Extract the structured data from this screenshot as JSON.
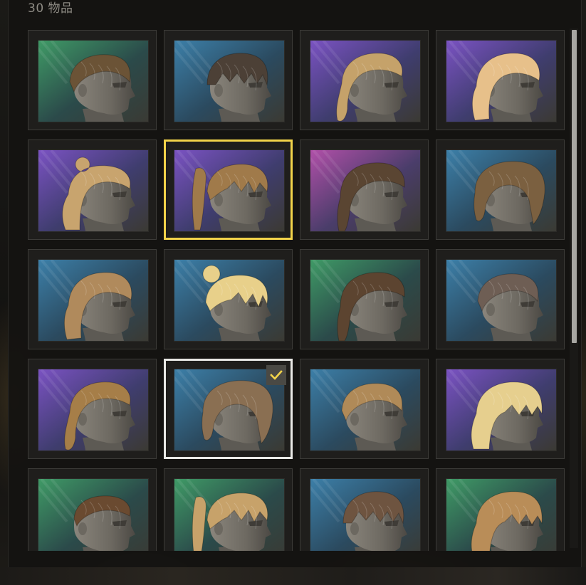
{
  "header": {
    "item_count": "30 物品"
  },
  "colors": {
    "focus_border": "#f2d34a",
    "equipped_border": "#e9e9e6",
    "check": "#f2d34a",
    "backgrounds": {
      "green": [
        "#3f9a66",
        "#2b4a4a",
        "#3a3a34"
      ],
      "blue": [
        "#3c7fa8",
        "#2b4a5f",
        "#3b3a33"
      ],
      "purple": [
        "#7a52c2",
        "#3f3d6e",
        "#3b3a33"
      ],
      "pink": [
        "#b04fa8",
        "#4a3d6a",
        "#3b3a33"
      ]
    }
  },
  "items": [
    {
      "bg": "green",
      "hair": "#6b5336",
      "style": "slick"
    },
    {
      "bg": "blue",
      "hair": "#4c4036",
      "style": "fringe"
    },
    {
      "bg": "purple",
      "hair": "#c5a26a",
      "style": "braid"
    },
    {
      "bg": "purple",
      "hair": "#e7c08a",
      "style": "long"
    },
    {
      "bg": "purple",
      "hair": "#c8a46e",
      "style": "bun-long"
    },
    {
      "bg": "purple",
      "hair": "#a07a4a",
      "style": "ponytail",
      "state": "focused"
    },
    {
      "bg": "pink",
      "hair": "#5a4532",
      "style": "cornrows"
    },
    {
      "bg": "blue",
      "hair": "#7b6040",
      "style": "bob"
    },
    {
      "bg": "blue",
      "hair": "#b08a5c",
      "style": "long"
    },
    {
      "bg": "blue",
      "hair": "#e8d08a",
      "style": "bun-fringe"
    },
    {
      "bg": "green",
      "hair": "#5c4430",
      "style": "cornrows"
    },
    {
      "bg": "blue",
      "hair": "#6e5e54",
      "style": "slick"
    },
    {
      "bg": "purple",
      "hair": "#a67e48",
      "style": "braid"
    },
    {
      "bg": "blue",
      "hair": "#8a6f52",
      "style": "bob",
      "state": "equipped"
    },
    {
      "bg": "blue",
      "hair": "#b08a58",
      "style": "slick"
    },
    {
      "bg": "purple",
      "hair": "#e6cf8e",
      "style": "fringe-long"
    },
    {
      "bg": "green",
      "hair": "#6a4a30",
      "style": "buzz"
    },
    {
      "bg": "green",
      "hair": "#c7a26a",
      "style": "ponytail"
    },
    {
      "bg": "blue",
      "hair": "#6e5440",
      "style": "fringe"
    },
    {
      "bg": "green",
      "hair": "#b98d58",
      "style": "fringe-long"
    }
  ]
}
